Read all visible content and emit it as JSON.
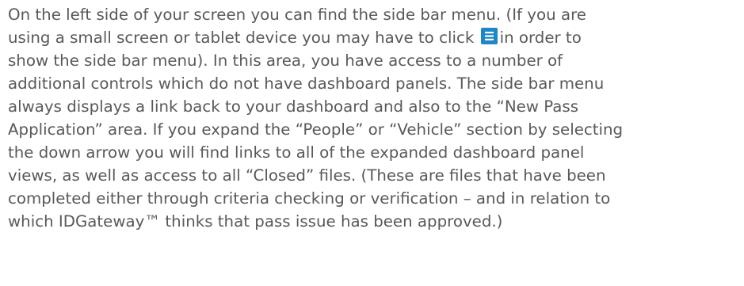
{
  "paragraph": {
    "lines": [
      "On the left side of your screen you can find the side bar menu. (If you are",
      "using a small screen or tablet device you may have to click",
      "in order to",
      "show the side bar menu).  In this area, you have access to a number of",
      "additional controls which do not have dashboard panels. The side bar menu",
      "always displays a link back to your dashboard and also to the “New Pass",
      "Application” area.  If you expand the “People” or “Vehicle” section by selecting",
      "the down arrow you will find links to all of the expanded dashboard panel",
      "views, as well as access to all “Closed” files. (These are files that have been",
      "completed either through criteria checking or verification – and in relation to",
      "which IDGateway™ thinks that pass issue has been approved.)"
    ]
  },
  "icons": {
    "menu": "hamburger-menu-icon"
  },
  "colors": {
    "text": "#595959",
    "icon_background": "#1d87c8",
    "icon_foreground": "#ffffff"
  }
}
